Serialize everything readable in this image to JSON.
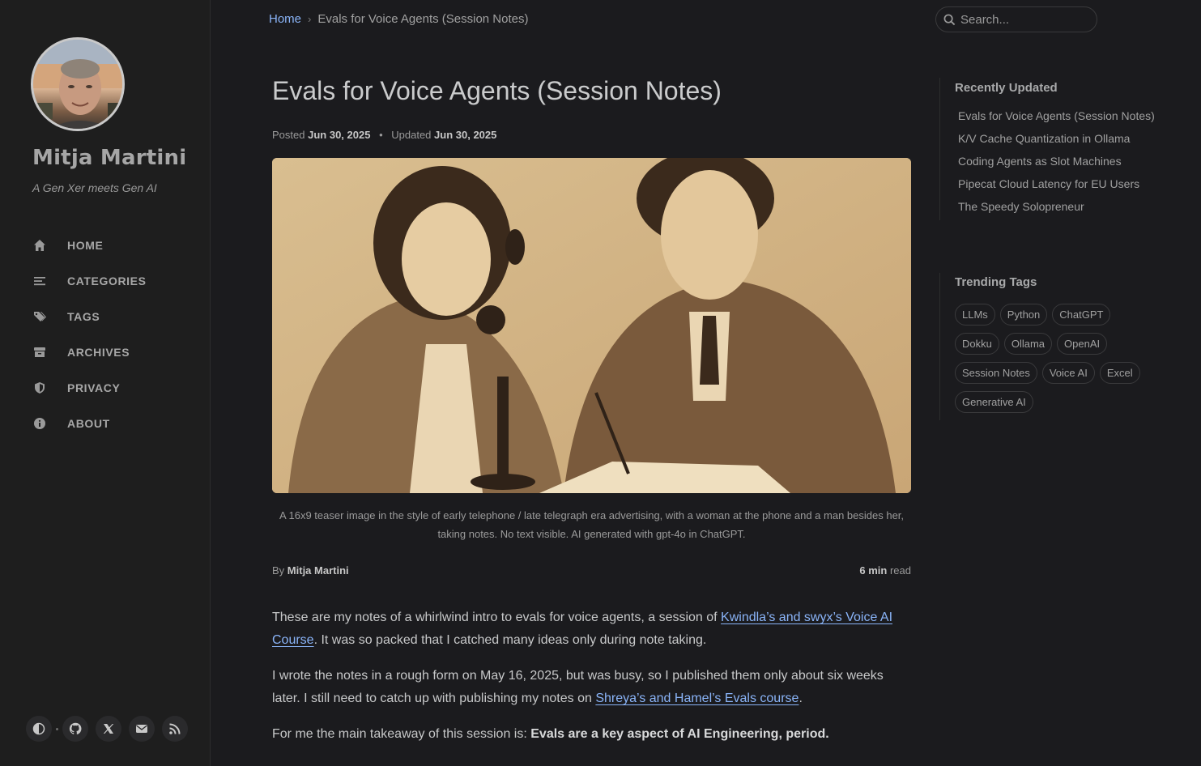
{
  "sidebar": {
    "title": "Mitja Martini",
    "subtitle": "A Gen Xer meets Gen AI",
    "nav": [
      {
        "label": "HOME",
        "icon": "home-icon"
      },
      {
        "label": "CATEGORIES",
        "icon": "list-icon"
      },
      {
        "label": "TAGS",
        "icon": "tags-icon"
      },
      {
        "label": "ARCHIVES",
        "icon": "archive-icon"
      },
      {
        "label": "PRIVACY",
        "icon": "shield-icon"
      },
      {
        "label": "ABOUT",
        "icon": "info-icon"
      }
    ],
    "bottom_icons": [
      "theme-toggle-icon",
      "github-icon",
      "x-twitter-icon",
      "email-icon",
      "rss-icon"
    ]
  },
  "topbar": {
    "breadcrumb_home": "Home",
    "breadcrumb_sep": "›",
    "breadcrumb_current": "Evals for Voice Agents (Session Notes)",
    "search_placeholder": "Search..."
  },
  "post": {
    "title": "Evals for Voice Agents (Session Notes)",
    "posted_label": "Posted",
    "posted_date": "Jun 30, 2025",
    "meta_sep": "•",
    "updated_label": "Updated",
    "updated_date": "Jun 30, 2025",
    "caption": "A 16x9 teaser image in the style of early telephone / late telegraph era advertising, with a woman at the phone and a man besides her, taking notes. No text visible. AI generated with gpt-4o in ChatGPT.",
    "by_label": "By",
    "author": "Mitja Martini",
    "read_time": "6 min",
    "read_label": "read",
    "p1_before": "These are my notes of a whirlwind intro to evals for voice agents, a session of ",
    "p1_link": "Kwindla’s and swyx’s Voice AI Course",
    "p1_after": ". It was so packed that I catched many ideas only during note taking.",
    "p2_before": "I wrote the notes in a rough form on May 16, 2025, but was busy, so I published them only about six weeks later. I still need to catch up with publishing my notes on ",
    "p2_link": "Shreya’s and Hamel’s Evals course",
    "p2_after": ".",
    "p3_before": "For me the main takeaway of this session is: ",
    "p3_bold": "Evals are a key aspect of AI Engineering, period."
  },
  "panel": {
    "recent_title": "Recently Updated",
    "recent": [
      "Evals for Voice Agents (Session Notes)",
      "K/V Cache Quantization in Ollama",
      "Coding Agents as Slot Machines",
      "Pipecat Cloud Latency for EU Users",
      "The Speedy Solopreneur"
    ],
    "tags_title": "Trending Tags",
    "tags": [
      "LLMs",
      "Python",
      "ChatGPT",
      "Dokku",
      "Ollama",
      "OpenAI",
      "Session Notes",
      "Voice AI",
      "Excel",
      "Generative AI"
    ]
  },
  "colors": {
    "background": "#1b1b1e",
    "sidebar": "#1e1e1e",
    "link": "#8ab4f8",
    "text": "#c7c8c9"
  }
}
